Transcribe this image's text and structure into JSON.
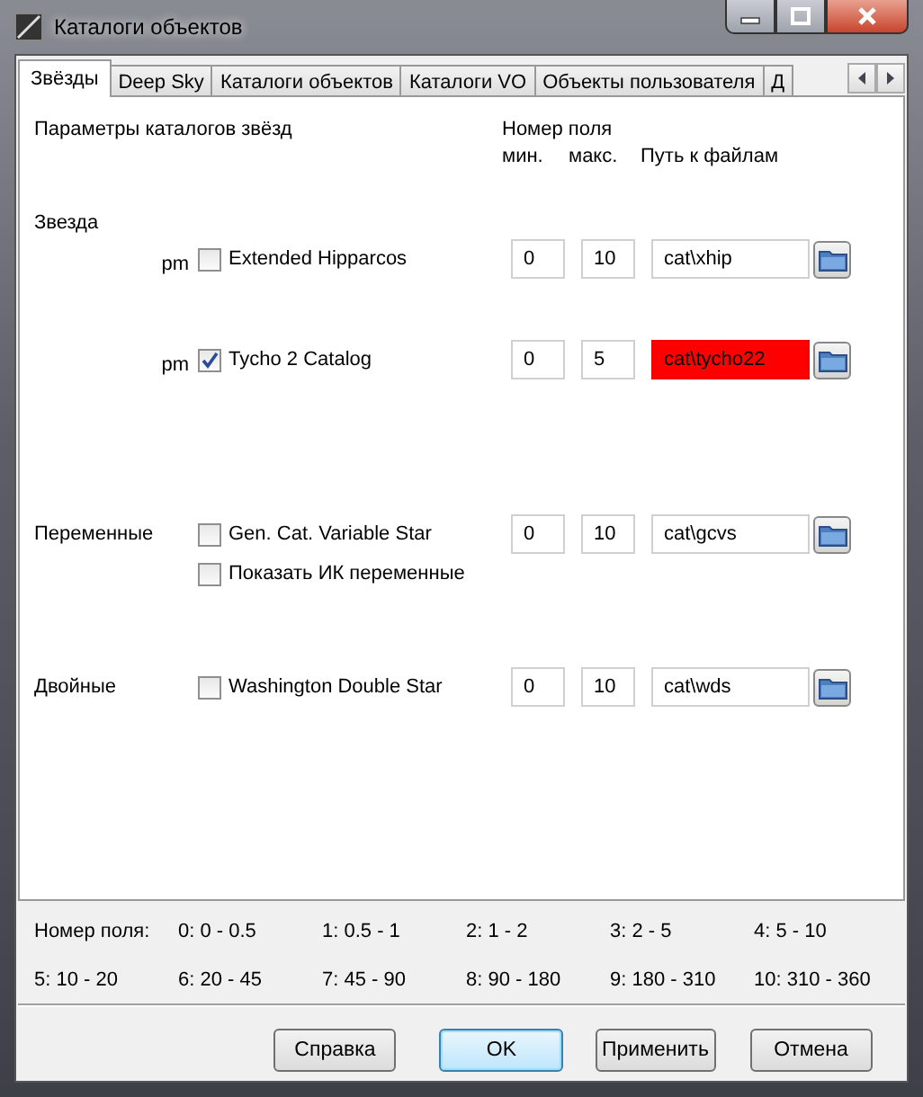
{
  "window": {
    "title": "Каталоги объектов"
  },
  "tabs": [
    {
      "label": "Звёзды",
      "selected": true
    },
    {
      "label": "Deep Sky",
      "selected": false
    },
    {
      "label": "Каталоги объектов",
      "selected": false
    },
    {
      "label": "Каталоги VO",
      "selected": false
    },
    {
      "label": "Объекты пользователя",
      "selected": false
    },
    {
      "label": "Д",
      "selected": false
    }
  ],
  "panel": {
    "title": "Параметры каталогов звёзд",
    "field_header": "Номер поля",
    "min_header": "мин.",
    "max_header": "макс.",
    "path_header": "Путь к файлам"
  },
  "groups": [
    {
      "label": "Звезда",
      "kind": "heading",
      "rows": [
        {
          "prefix": "pm",
          "name": "Extended Hipparcos",
          "checked": false,
          "min": "0",
          "max": "10",
          "path": "cat\\xhip",
          "error": false
        },
        {
          "prefix": "pm",
          "name": "Tycho 2 Catalog",
          "checked": true,
          "min": "0",
          "max": "5",
          "path": "cat\\tycho22",
          "error": true
        }
      ]
    },
    {
      "label": "Переменные",
      "kind": "inline",
      "rows": [
        {
          "name": "Gen. Cat. Variable Star",
          "checked": false,
          "min": "0",
          "max": "10",
          "path": "cat\\gcvs",
          "error": false
        }
      ],
      "options": [
        {
          "name": "Показать ИК переменные",
          "checked": false
        }
      ]
    },
    {
      "label": "Двойные",
      "kind": "inline",
      "rows": [
        {
          "name": "Washington Double Star",
          "checked": false,
          "min": "0",
          "max": "10",
          "path": "cat\\wds",
          "error": false
        }
      ]
    }
  ],
  "legend": {
    "label": "Номер поля:",
    "items": [
      "0: 0 - 0.5",
      "1: 0.5 - 1",
      "2: 1 - 2",
      "3: 2 - 5",
      "4: 5 - 10",
      "5: 10 - 20",
      "6: 20 - 45",
      "7: 45 - 90",
      "8: 90 - 180",
      "9: 180 - 310",
      "10: 310 - 360"
    ]
  },
  "buttons": [
    {
      "label": "Справка",
      "default": false
    },
    {
      "label": "OK",
      "default": true
    },
    {
      "label": "Применить",
      "default": false
    },
    {
      "label": "Отмена",
      "default": false
    }
  ]
}
